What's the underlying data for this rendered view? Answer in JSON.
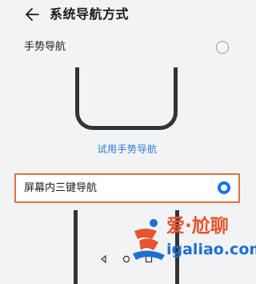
{
  "header": {
    "title": "系统导航方式"
  },
  "options": {
    "gesture": {
      "label": "手势导航",
      "selected": false
    },
    "try_gesture_link": "试用手势导航",
    "three_key": {
      "label": "屏幕内三键导航",
      "selected": true
    }
  },
  "colors": {
    "accent": "#1a73e8",
    "highlight_border": "#e0743c",
    "link": "#2a7bd6"
  },
  "watermark": {
    "brand": "爱·尬聊",
    "url": "igaliao.com"
  },
  "icons": {
    "back": "arrow-left-icon",
    "nav_back": "triangle-back-icon",
    "nav_home": "circle-home-icon",
    "nav_recent": "square-recent-icon"
  }
}
